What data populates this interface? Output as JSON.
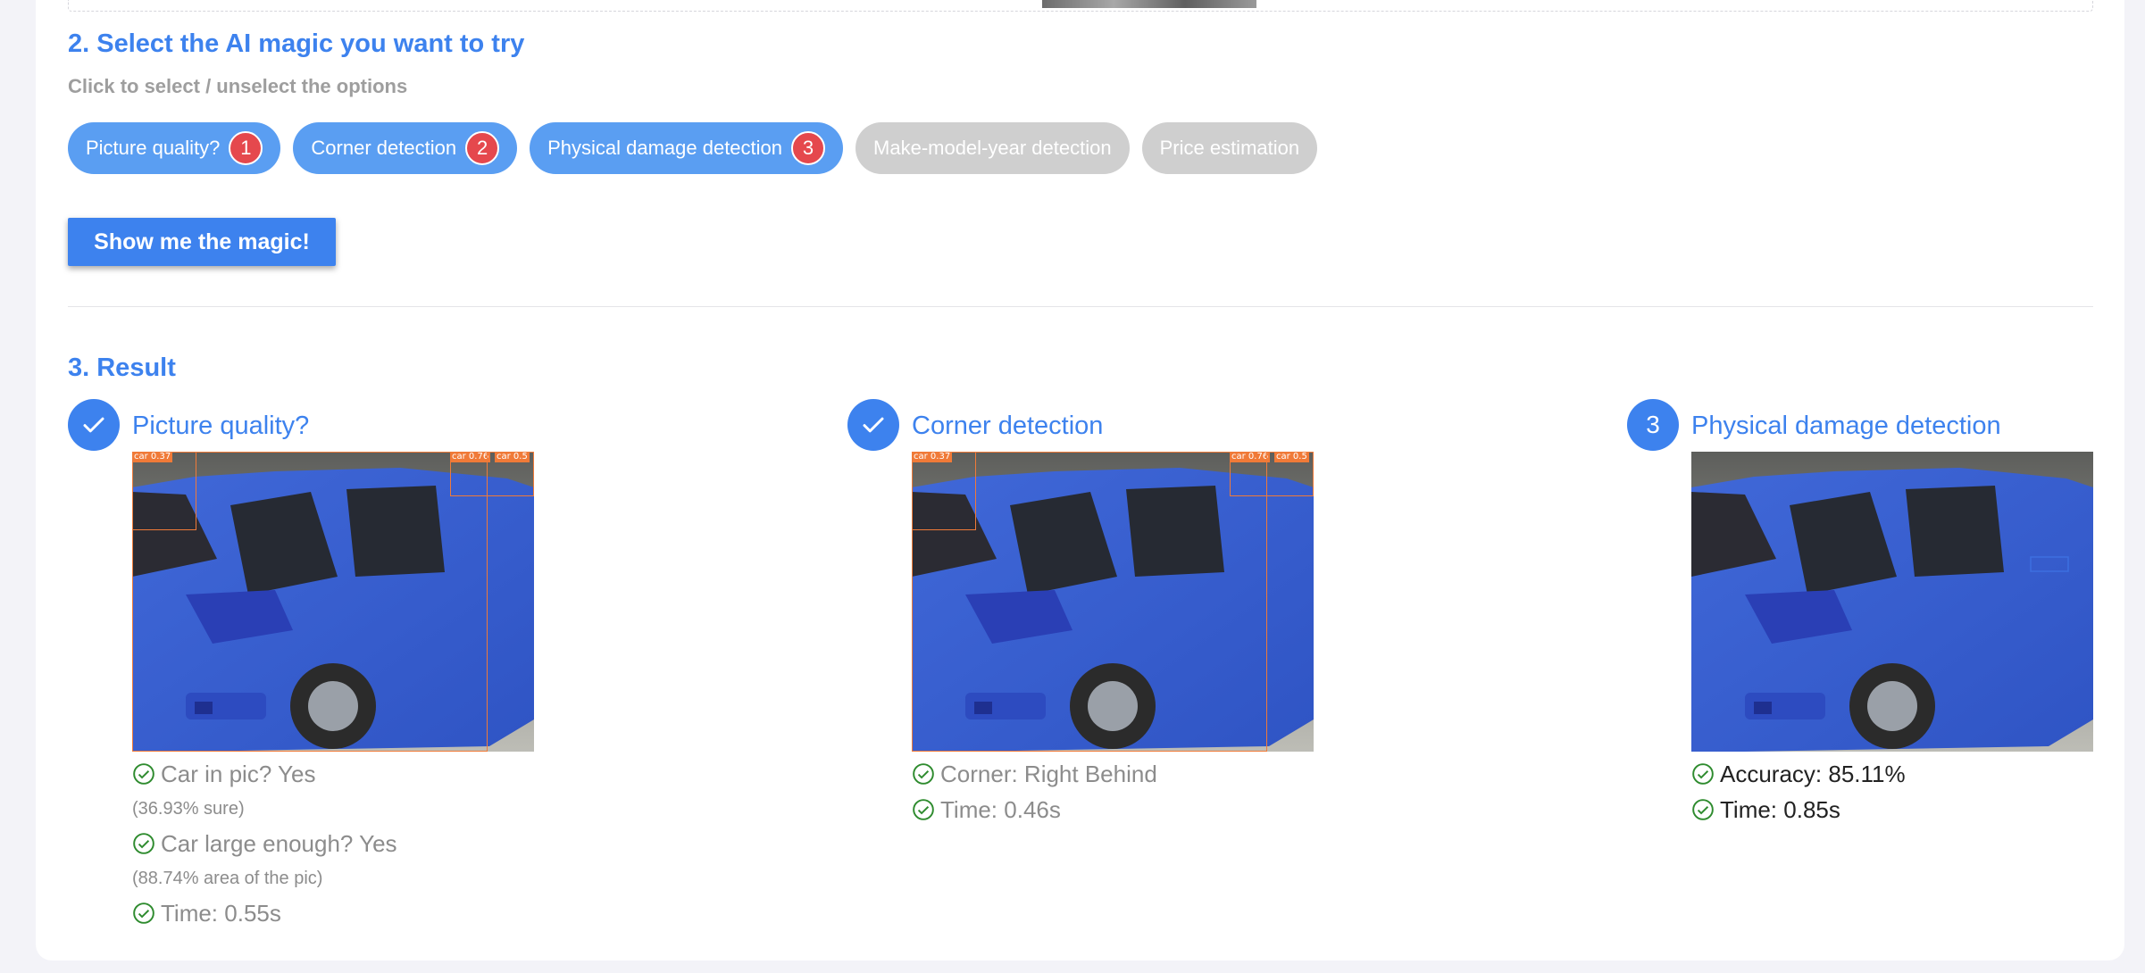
{
  "section2": {
    "title": "2. Select the AI magic you want to try",
    "subtitle": "Click to select / unselect the options",
    "options": [
      {
        "label": "Picture quality?",
        "selected": true,
        "order": "1"
      },
      {
        "label": "Corner detection",
        "selected": true,
        "order": "2"
      },
      {
        "label": "Physical damage detection",
        "selected": true,
        "order": "3"
      },
      {
        "label": "Make-model-year detection",
        "selected": false,
        "order": ""
      },
      {
        "label": "Price estimation",
        "selected": false,
        "order": ""
      }
    ],
    "button_label": "Show me the magic!"
  },
  "section3": {
    "title": "3. Result",
    "results": [
      {
        "badge": "",
        "badge_icon": "check-icon",
        "title": "Picture quality?",
        "detections": [
          {
            "label": "car 0.37"
          },
          {
            "label": "car 0.76"
          },
          {
            "label": "car 0.5"
          }
        ],
        "lines": [
          {
            "text": "Car in pic? Yes",
            "sub": "(36.93% sure)"
          },
          {
            "text": "Car large enough? Yes",
            "sub": "(88.74% area of the pic)"
          },
          {
            "text": "Time: 0.55s",
            "sub": ""
          }
        ]
      },
      {
        "badge": "",
        "badge_icon": "check-icon",
        "title": "Corner detection",
        "detections": [
          {
            "label": "car 0.37"
          },
          {
            "label": "car 0.76"
          },
          {
            "label": "car 0.5"
          }
        ],
        "lines": [
          {
            "text": "Corner: Right Behind",
            "sub": ""
          },
          {
            "text": "Time: 0.46s",
            "sub": ""
          }
        ]
      },
      {
        "badge": "3",
        "badge_icon": "",
        "title": "Physical damage detection",
        "detections": [],
        "lines": [
          {
            "text": "Accuracy: 85.11%",
            "sub": ""
          },
          {
            "text": "Time: 0.85s",
            "sub": ""
          }
        ]
      }
    ]
  },
  "colors": {
    "accent": "#3d82ee",
    "pill_selected": "#5a9ef2",
    "pill_unselected": "#cfcfcf",
    "order_badge": "#e5484d",
    "success_check": "#2e8b2e",
    "detection_box": "#f07a38"
  }
}
